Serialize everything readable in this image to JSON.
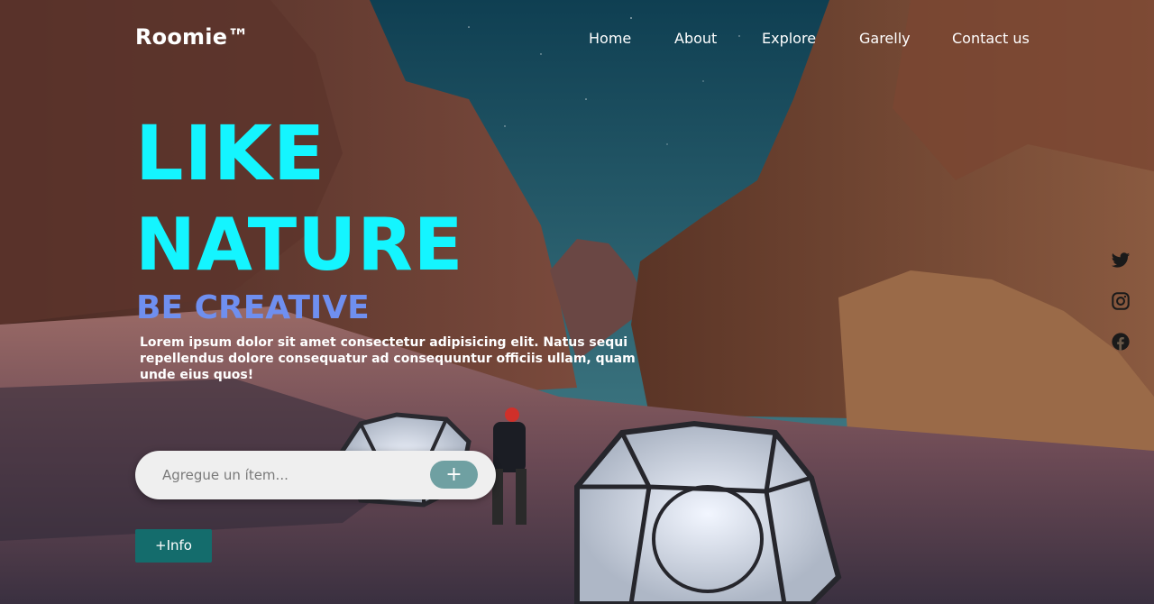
{
  "brand": {
    "logo": "Roomie™"
  },
  "nav": {
    "items": [
      {
        "label": "Home"
      },
      {
        "label": "About"
      },
      {
        "label": "Explore"
      },
      {
        "label": "Garelly"
      },
      {
        "label": "Contact us"
      }
    ]
  },
  "hero": {
    "title_line1": "LIKE",
    "title_line2": "NATURE",
    "subtitle": "BE CREATIVE",
    "description": "Lorem ipsum dolor sit amet consectetur adipisicing elit. Natus sequi repellendus dolore consequatur ad consequuntur officiis ullam, quam unde eius quos!"
  },
  "search": {
    "placeholder": "Agregue un ítem...",
    "value": "",
    "add_label": "+"
  },
  "info_button": {
    "label": "+Info"
  },
  "social": {
    "icons": [
      "twitter-icon",
      "instagram-icon",
      "facebook-icon"
    ]
  },
  "colors": {
    "title": "#14f5ff",
    "subtitle": "#6f8ff0",
    "info_button": "#146c6c",
    "add_button": "#6fa0a2"
  }
}
